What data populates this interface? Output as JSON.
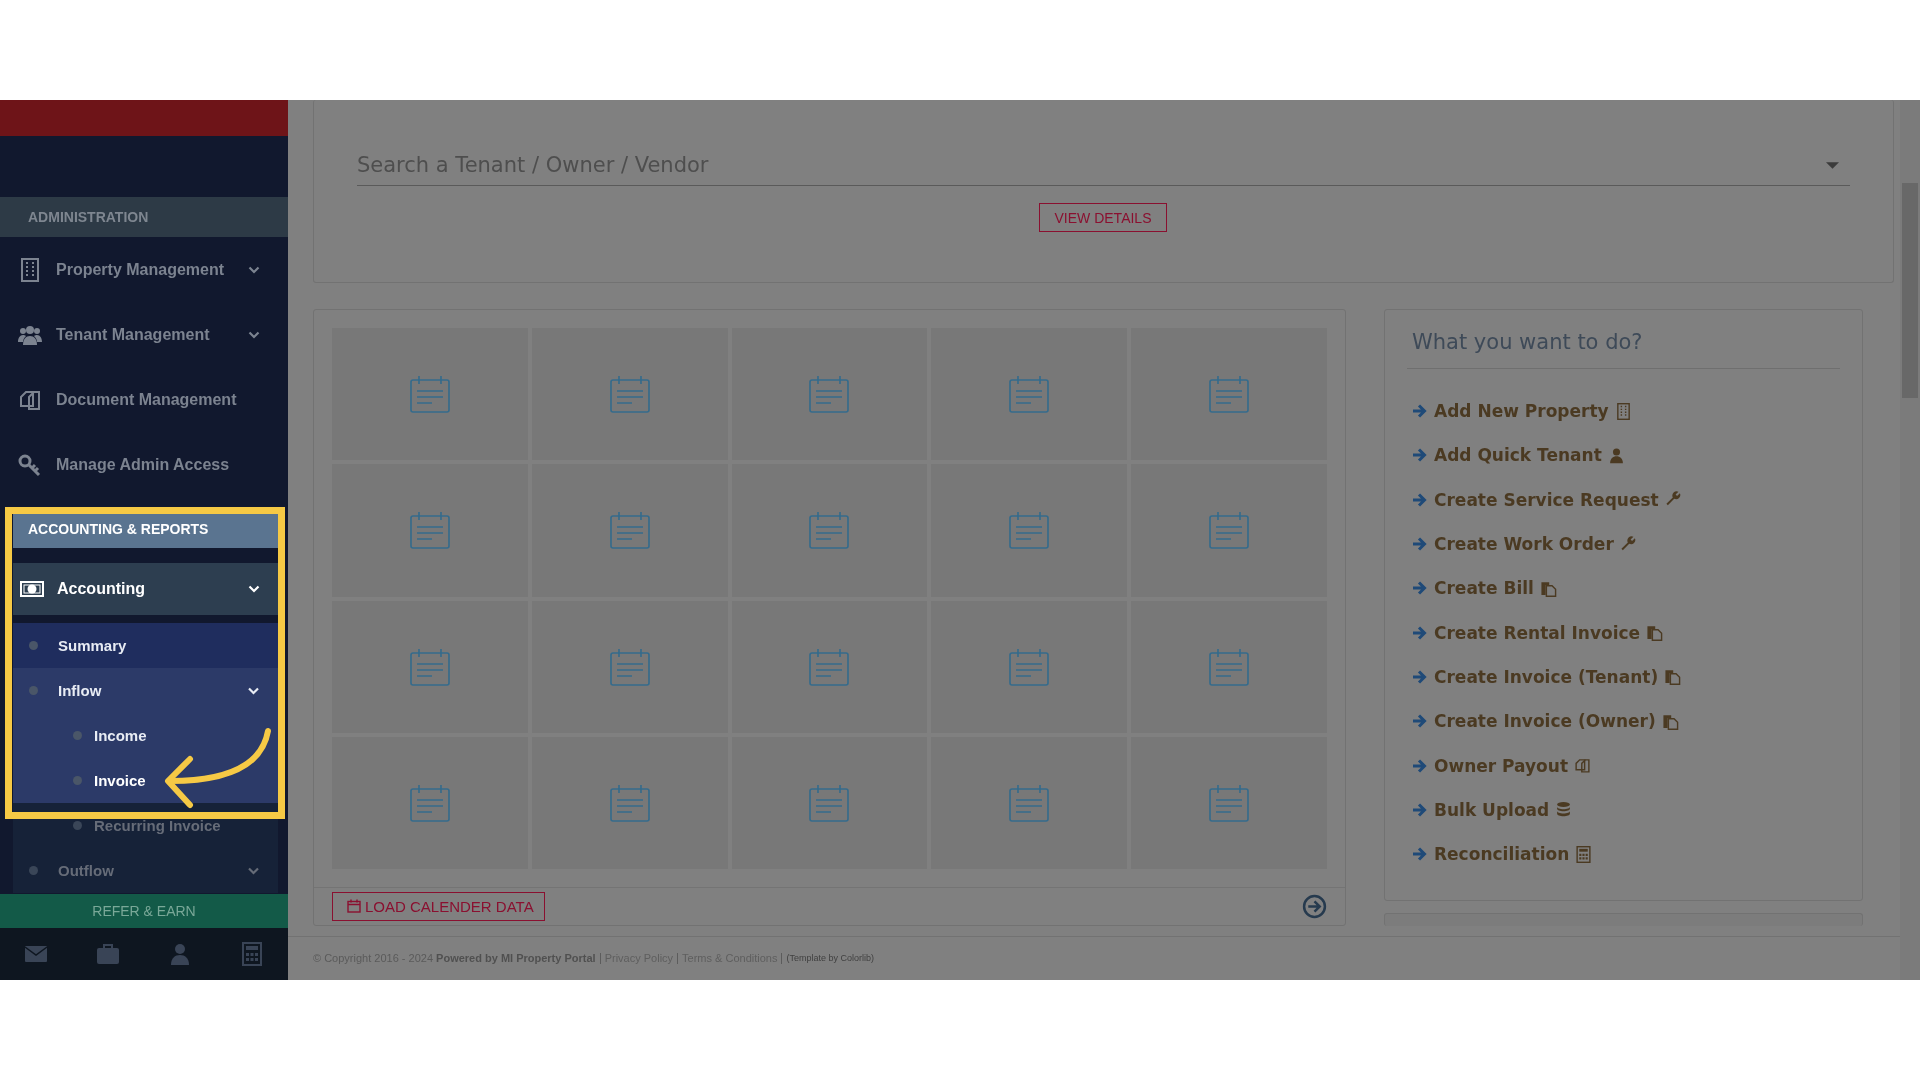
{
  "sidebar": {
    "sections": [
      {
        "title": "ADMINISTRATION",
        "highlighted": false,
        "items": [
          {
            "label": "Property Management",
            "kind": "group",
            "expanded": false
          },
          {
            "label": "Tenant Management",
            "kind": "group",
            "expanded": false
          },
          {
            "label": "Document Management",
            "kind": "link",
            "expanded": false
          },
          {
            "label": "Manage Admin Access",
            "kind": "link",
            "expanded": false
          }
        ]
      },
      {
        "title": "ACCOUNTING & REPORTS",
        "highlighted": true,
        "items": [
          {
            "label": "Accounting",
            "kind": "group",
            "expanded": true,
            "children": [
              {
                "label": "Summary",
                "kind": "link",
                "expanded": false,
                "selected": false,
                "highlighted": true
              },
              {
                "label": "Inflow",
                "kind": "group",
                "expanded": true,
                "selected": false,
                "highlighted": true,
                "children": [
                  {
                    "label": "Income",
                    "selected": false,
                    "highlighted": true
                  },
                  {
                    "label": "Invoice",
                    "selected": true,
                    "highlighted": true
                  },
                  {
                    "label": "Recurring Invoice",
                    "selected": false,
                    "highlighted": false
                  }
                ]
              },
              {
                "label": "Outflow",
                "kind": "group",
                "expanded": false,
                "selected": false,
                "highlighted": false
              }
            ]
          }
        ]
      }
    ],
    "refer_button": "REFER & EARN"
  },
  "search": {
    "placeholder": "Search a Tenant / Owner / Vendor",
    "button": "VIEW DETAILS"
  },
  "calendar_grid": [
    [
      {
        "kind": "calendar"
      },
      {
        "kind": "calendar"
      },
      {
        "kind": "calendar"
      },
      {
        "kind": "calendar"
      },
      {
        "kind": "calendar"
      }
    ],
    [
      {
        "kind": "calendar"
      },
      {
        "kind": "calendar"
      },
      {
        "kind": "calendar"
      },
      {
        "kind": "calendar"
      },
      {
        "kind": "calendar"
      }
    ],
    [
      {
        "kind": "calendar"
      },
      {
        "kind": "calendar"
      },
      {
        "kind": "calendar"
      },
      {
        "kind": "calendar"
      },
      {
        "kind": "calendar"
      }
    ],
    [
      {
        "kind": "calendar"
      },
      {
        "kind": "calendar"
      },
      {
        "kind": "calendar"
      },
      {
        "kind": "calendar"
      },
      {
        "kind": "calendar"
      }
    ]
  ],
  "load_button": "LOAD CALENDER DATA",
  "quick_actions": {
    "title": "What you want to do?",
    "items": [
      {
        "label": "Add New Property"
      },
      {
        "label": "Add Quick Tenant"
      },
      {
        "label": "Create Service Request"
      },
      {
        "label": "Create Work Order"
      },
      {
        "label": "Create Bill"
      },
      {
        "label": "Create Rental Invoice"
      },
      {
        "label": "Create Invoice (Tenant)"
      },
      {
        "label": "Create Invoice (Owner)"
      },
      {
        "label": "Owner Payout"
      },
      {
        "label": "Bulk Upload"
      },
      {
        "label": "Reconciliation"
      }
    ]
  },
  "footer": [
    {
      "kind": "text",
      "text": "© Copyright 2016 - 2024 **Powered by MI Property Portal**"
    },
    {
      "kind": "link",
      "text": "Privacy Policy"
    },
    {
      "kind": "link",
      "text": "Terms & Conditions"
    },
    {
      "kind": "note",
      "text": "(Template by Colorlib)"
    }
  ]
}
